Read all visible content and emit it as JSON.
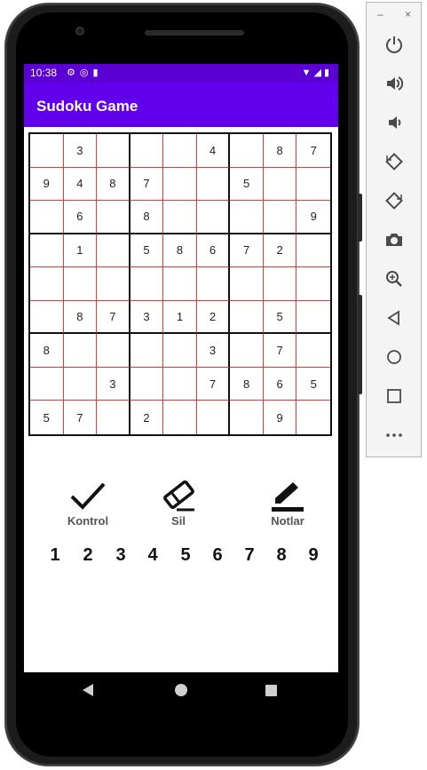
{
  "status_bar": {
    "time": "10:38",
    "left_icons": [
      "gear-icon",
      "signal-app-icon",
      "sdcard-icon"
    ],
    "right_icons": [
      "wifi-icon",
      "cell-signal-icon",
      "battery-icon"
    ]
  },
  "app_bar": {
    "title": "Sudoku Game"
  },
  "grid": {
    "rows": [
      [
        "",
        "3",
        "",
        "",
        "",
        "4",
        "",
        "8",
        "7"
      ],
      [
        "9",
        "4",
        "8",
        "7",
        "",
        "",
        "5",
        "",
        ""
      ],
      [
        "",
        "6",
        "",
        "8",
        "",
        "",
        "",
        "",
        "9"
      ],
      [
        "",
        "1",
        "",
        "5",
        "8",
        "6",
        "7",
        "2",
        ""
      ],
      [
        "",
        "",
        "",
        "",
        "",
        "",
        "",
        "",
        ""
      ],
      [
        "",
        "8",
        "7",
        "3",
        "1",
        "2",
        "",
        "5",
        ""
      ],
      [
        "8",
        "",
        "",
        "",
        "",
        "3",
        "",
        "7",
        ""
      ],
      [
        "",
        "",
        "3",
        "",
        "",
        "7",
        "8",
        "6",
        "5"
      ],
      [
        "5",
        "7",
        "",
        "2",
        "",
        "",
        "",
        "9",
        ""
      ]
    ]
  },
  "actions": {
    "check": {
      "label": "Kontrol",
      "icon": "check-icon"
    },
    "erase": {
      "label": "Sil",
      "icon": "eraser-icon"
    },
    "notes": {
      "label": "Notlar",
      "icon": "pencil-icon"
    }
  },
  "numbers": [
    "1",
    "2",
    "3",
    "4",
    "5",
    "6",
    "7",
    "8",
    "9"
  ],
  "emulator_toolbar": {
    "minimize": "–",
    "close": "×",
    "buttons": [
      "power-icon",
      "volume-up-icon",
      "volume-down-icon",
      "rotate-left-icon",
      "rotate-right-icon",
      "camera-icon",
      "zoom-icon",
      "back-icon",
      "home-icon",
      "overview-icon",
      "more-icon"
    ]
  },
  "colors": {
    "primary": "#6200ee",
    "status": "#5b00d4",
    "grid_line": "#e23a3a"
  }
}
